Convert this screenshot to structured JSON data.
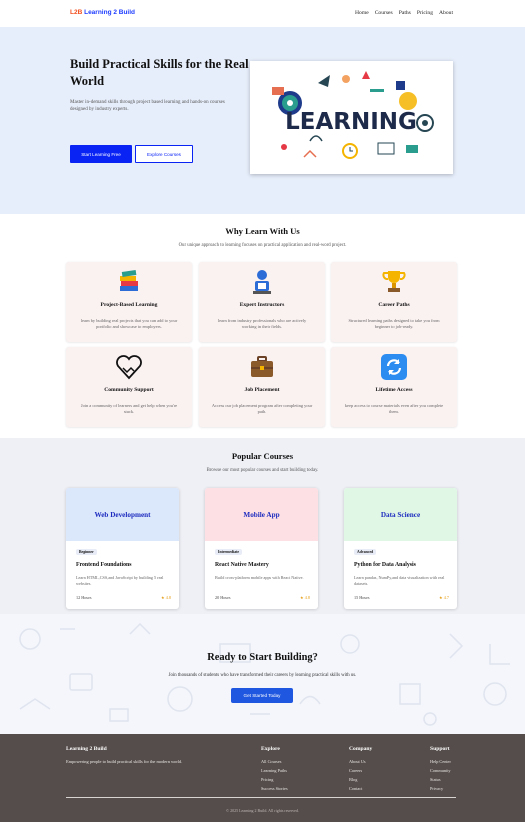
{
  "nav": {
    "logo_prefix": "L2B",
    "logo_text": "Learning 2 Build",
    "links": [
      "Home",
      "Courses",
      "Paths",
      "Pricing",
      "About"
    ]
  },
  "hero": {
    "title": "Build Practical Skills for the Real World",
    "description": "Master in-demand skills through project based learning and hands-on courses designed by industry experts.",
    "primary_button": "Start Learning Free",
    "secondary_button": "Explore Courses",
    "image_text": "LEARNING"
  },
  "why": {
    "title": "Why Learn With Us",
    "subtitle": "Our unique approach to learning focuses on practical application and real-word project.",
    "features": [
      {
        "icon": "books-icon",
        "title": "Project-Based Learning",
        "desc": "learn by building real projects that you can add to your portfolio and showcase to employers."
      },
      {
        "icon": "instructor-icon",
        "title": "Expert Instructors",
        "desc": "learn from industry professionals who are actively working in their fields."
      },
      {
        "icon": "trophy-icon",
        "title": "Career Paths",
        "desc": "Structured learning paths designed to take you from beginner to job-ready."
      },
      {
        "icon": "handshake-heart-icon",
        "title": "Community Support",
        "desc": "Join a community of learners and get help when you're stuck."
      },
      {
        "icon": "briefcase-icon",
        "title": "Job Placement",
        "desc": "Access our job placement program after completing your path."
      },
      {
        "icon": "refresh-icon",
        "title": "Lifetime Access",
        "desc": "keep access to course materials even after you complete them."
      }
    ]
  },
  "courses": {
    "title": "Popular Courses",
    "subtitle": "Browse our most popular courses and start building today.",
    "items": [
      {
        "banner": "Web Development",
        "level": "Beginner",
        "name": "Frontend Foundations",
        "desc": "Learn HTML,CSS,and JavaScript by building 5 real websites.",
        "hours": "12 Hours",
        "rating": "4.8"
      },
      {
        "banner": "Mobile App",
        "level": "Intermediate",
        "name": "React Native Mastery",
        "desc": "Build cross-platform mobile apps with React Native.",
        "hours": "20 Hours",
        "rating": "4.8"
      },
      {
        "banner": "Data Science",
        "level": "Advanced",
        "name": "Python for Data Analysis",
        "desc": "Learn pandas, NumPy,and data visualization with real datasets.",
        "hours": "15 Hours",
        "rating": "4.7"
      }
    ]
  },
  "cta": {
    "title": "Ready to Start Building?",
    "desc": "Join thousands of students who have transformed their careers by learning practical skills with us.",
    "button": "Get Started Today"
  },
  "footer": {
    "brand": "Learning 2 Build",
    "tagline": "Empowering people to build practical skills for the modern world.",
    "columns": [
      {
        "heading": "Explore",
        "links": [
          "All Courses",
          "Learning Paths",
          "Pricing",
          "Success Stories"
        ]
      },
      {
        "heading": "Company",
        "links": [
          "About Us",
          "Careers",
          "Blog",
          "Contact"
        ]
      },
      {
        "heading": "Support",
        "links": [
          "Help Center",
          "Community",
          "Status",
          "Privacy"
        ]
      }
    ],
    "copyright": "© 2025 Learning 2 Build. All rights reserved."
  },
  "colors": {
    "accent": "#0a23f5",
    "hero_bg": "#e7eefb",
    "card_bg": "#faf1f1",
    "footer_bg": "#554d4b",
    "web_banner": "#dbe7fb",
    "mobile_banner": "#fde0e4",
    "data_banner": "#e0f7e6"
  }
}
